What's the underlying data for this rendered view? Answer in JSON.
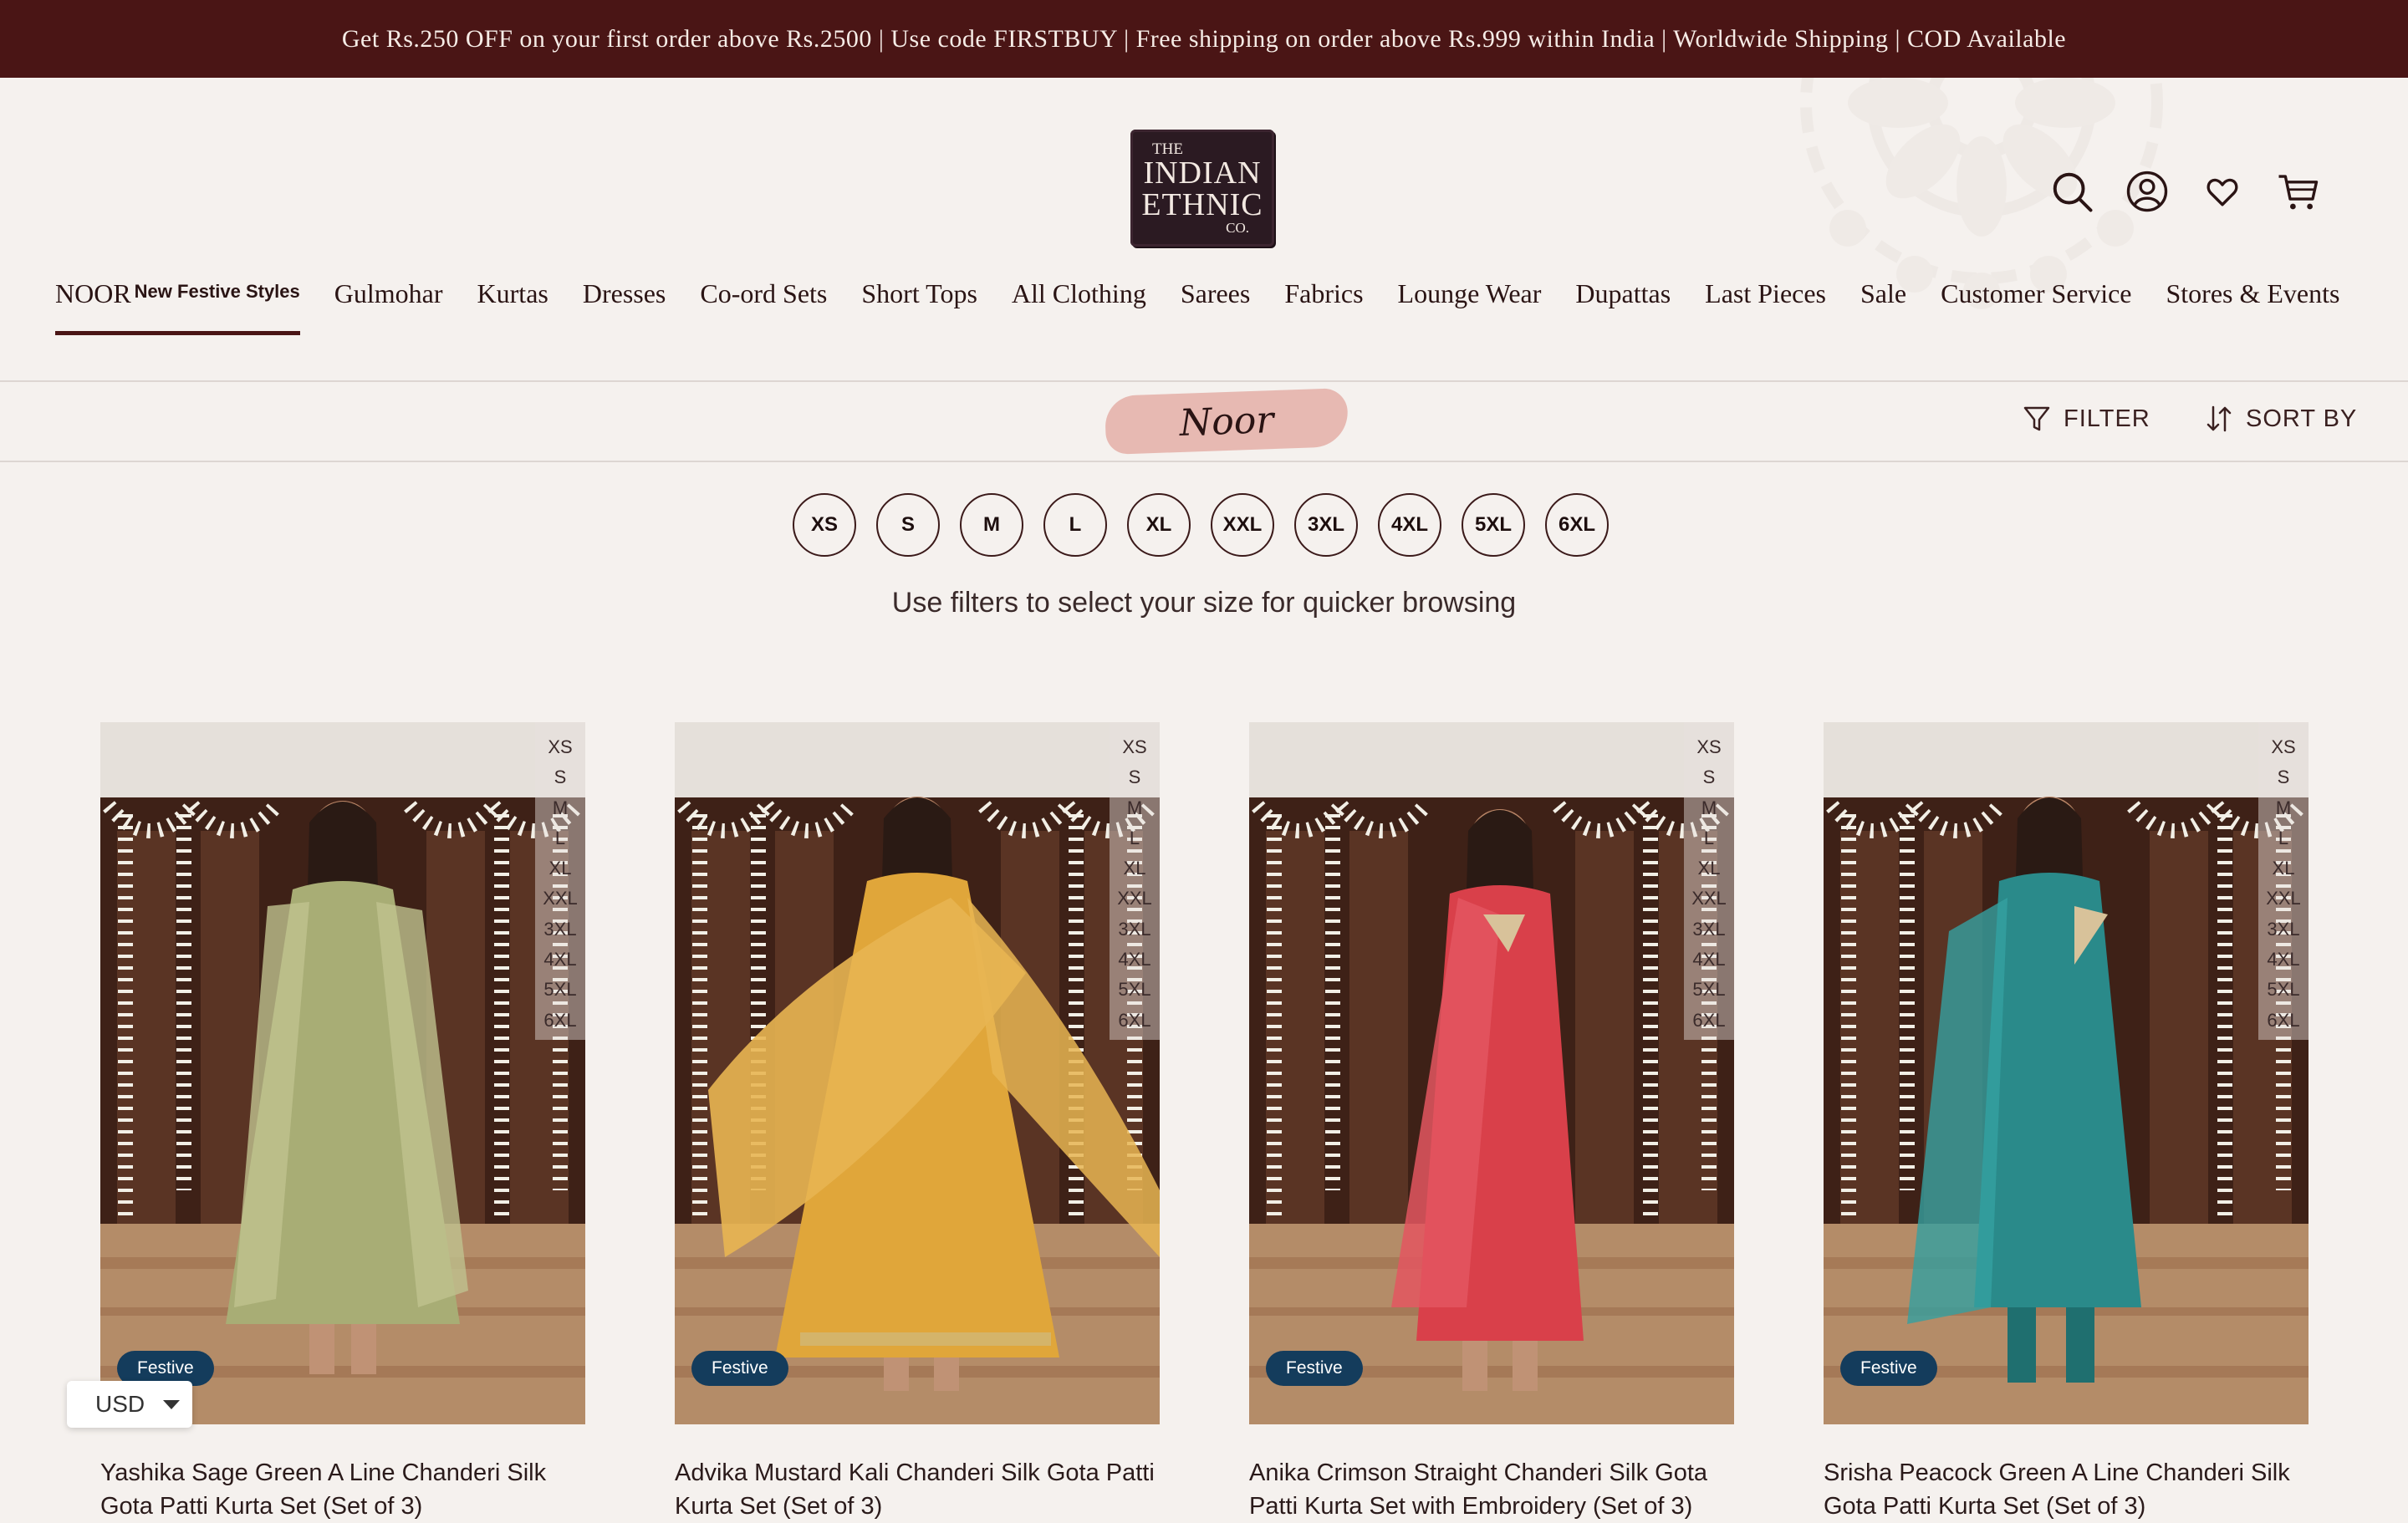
{
  "announcement": "Get Rs.250 OFF on your first order above Rs.2500 | Use code FIRSTBUY | Free shipping on order above Rs.999 within India | Worldwide Shipping | COD Available",
  "logo": {
    "line1": "THE",
    "line2": "INDIAN",
    "line3": "ETHNIC",
    "line4": "CO."
  },
  "header_icons": [
    "search-icon",
    "account-icon",
    "wishlist-heart-icon",
    "cart-icon"
  ],
  "nav": {
    "noor_label": "NOOR",
    "noor_tag": "New Festive Styles",
    "items": [
      "Gulmohar",
      "Kurtas",
      "Dresses",
      "Co-ord Sets",
      "Short Tops",
      "All Clothing",
      "Sarees",
      "Fabrics",
      "Lounge Wear",
      "Dupattas",
      "Last Pieces",
      "Sale",
      "Customer Service",
      "Stores & Events"
    ]
  },
  "collection": {
    "title": "Noor"
  },
  "toolbar": {
    "filter_label": "FILTER",
    "sort_label": "SORT BY"
  },
  "size_filters": [
    "XS",
    "S",
    "M",
    "L",
    "XL",
    "XXL",
    "3XL",
    "4XL",
    "5XL",
    "6XL"
  ],
  "size_hint": "Use filters to select your size for quicker browsing",
  "products": [
    {
      "title": "Yashika Sage Green A Line Chanderi Silk Gota Patti Kurta Set (Set of 3)",
      "badge": "Festive",
      "sizes": [
        "XS",
        "S",
        "M",
        "L",
        "XL",
        "XXL",
        "3XL",
        "4XL",
        "5XL",
        "6XL"
      ]
    },
    {
      "title": "Advika Mustard Kali Chanderi Silk Gota Patti Kurta Set (Set of 3)",
      "badge": "Festive",
      "sizes": [
        "XS",
        "S",
        "M",
        "L",
        "XL",
        "XXL",
        "3XL",
        "4XL",
        "5XL",
        "6XL"
      ]
    },
    {
      "title": "Anika Crimson Straight Chanderi Silk Gota Patti Kurta Set with Embroidery (Set of 3)",
      "badge": "Festive",
      "sizes": [
        "XS",
        "S",
        "M",
        "L",
        "XL",
        "XXL",
        "3XL",
        "4XL",
        "5XL",
        "6XL"
      ]
    },
    {
      "title": "Srisha Peacock Green A Line Chanderi Silk Gota Patti Kurta Set (Set of 3)",
      "badge": "Festive",
      "sizes": [
        "XS",
        "S",
        "M",
        "L",
        "XL",
        "XXL",
        "3XL",
        "4XL",
        "5XL",
        "6XL"
      ]
    }
  ],
  "currency": {
    "selected": "USD"
  },
  "colors": {
    "brand": "#4a1515",
    "background": "#f5f1ee",
    "badge": "#143c5c",
    "noor_badge": "#e7b9b2"
  }
}
